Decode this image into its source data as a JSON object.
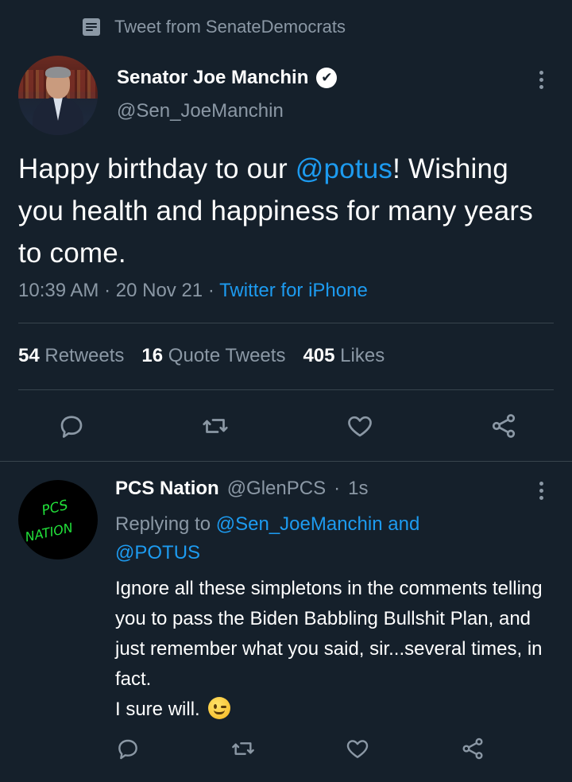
{
  "context": {
    "label": "Tweet from SenateDemocrats",
    "icon": "document-icon"
  },
  "tweet": {
    "author_name": "Senator Joe Manchin",
    "handle": "@Sen_JoeManchin",
    "verified_glyph": "✔",
    "text_part1": "Happy birthday to our ",
    "mention": "@potus",
    "text_part2": "! Wishing you health and happiness for many years to come.",
    "time": "10:39 AM",
    "date": "20 Nov 21",
    "sep": "·",
    "source": "Twitter for iPhone",
    "stats": [
      {
        "count": "54",
        "label": "Retweets"
      },
      {
        "count": "16",
        "label": "Quote Tweets"
      },
      {
        "count": "405",
        "label": "Likes"
      }
    ]
  },
  "reply": {
    "author_name": "PCS Nation",
    "handle": "@GlenPCS",
    "sep": "·",
    "time": "1s",
    "avatar_text_top": "PCS",
    "avatar_text_bottom": "NATION",
    "replying_prefix": "Replying to ",
    "replying_to_1": "@Sen_JoeManchin",
    "replying_and": " and",
    "replying_to_2": "@POTUS",
    "text": "Ignore all these simpletons in the comments telling you to pass the Biden Babbling Bullshit Plan, and just remember what you said, sir...several times, in fact.",
    "text_line2": "I sure will."
  },
  "colors": {
    "background": "#15202b",
    "accent": "#1d9bf0",
    "muted": "#8b98a5",
    "divider": "#38444d",
    "avatar_text": "#22e33b"
  },
  "icons": [
    "reply-icon",
    "retweet-icon",
    "like-icon",
    "share-icon",
    "more-icon",
    "verified-badge-icon"
  ]
}
